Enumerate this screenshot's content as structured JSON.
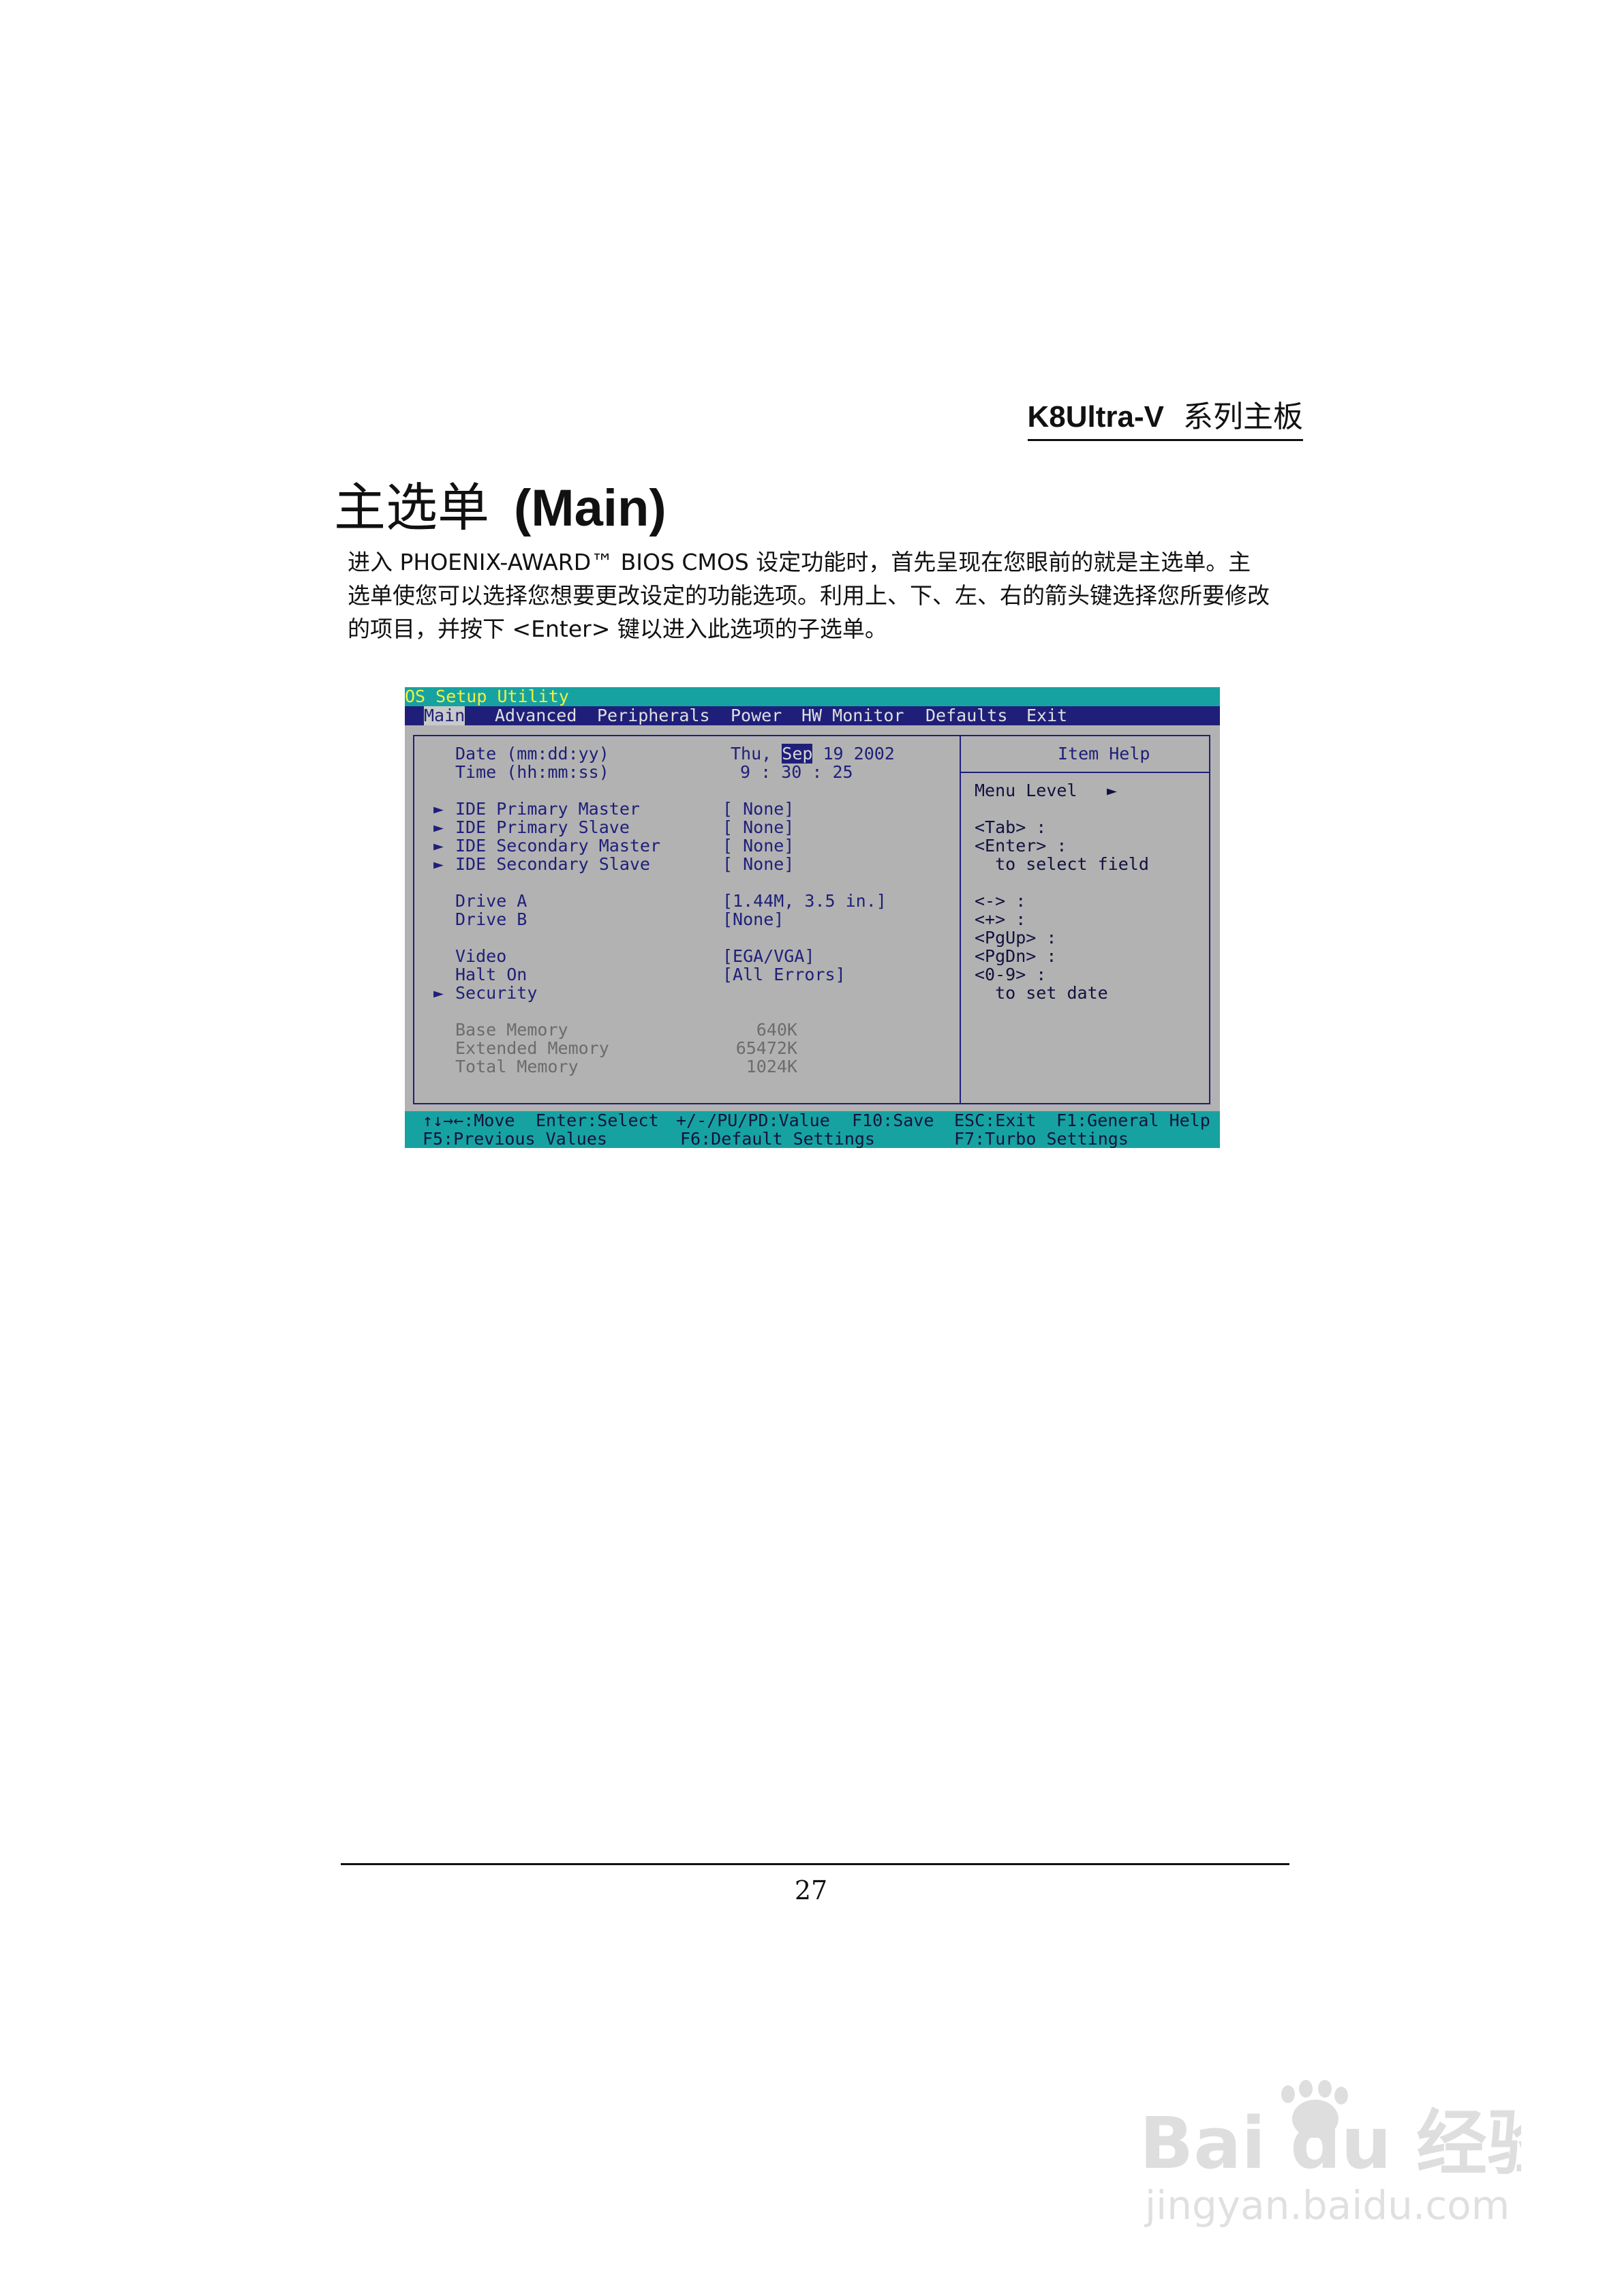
{
  "header": {
    "model": "K8Ultra-V",
    "suffix": "系列主板"
  },
  "section": {
    "title_cn": "主选单",
    "title_en": "(Main)"
  },
  "intro": {
    "lines": [
      "进入 PHOENIX-AWARD™ BIOS CMOS 设定功能时，首先呈现在您眼前的就是主选单。主",
      "选单使您可以选择您想要更改设定的功能选项。利用上、下、左、右的箭头键选择您所要修改",
      "的项目，并按下 <Enter> 键以进入此选项的子选单。"
    ]
  },
  "bios": {
    "title": "OS Setup Utility",
    "menu": [
      "Main",
      "Advanced",
      "Peripherals",
      "Power",
      "HW Monitor",
      "Defaults",
      "Exit"
    ],
    "date": {
      "label": "Date (mm:dd:yy)",
      "day": "Thu,",
      "month": "Sep",
      "rest": "19 2002"
    },
    "time": {
      "label": "Time (hh:mm:ss)",
      "value": "9 : 30 : 25"
    },
    "ide": [
      {
        "arrow": "►",
        "label": "IDE Primary Master",
        "value": "[ None]"
      },
      {
        "arrow": "►",
        "label": "IDE Primary Slave",
        "value": "[ None]"
      },
      {
        "arrow": "►",
        "label": "IDE Secondary Master",
        "value": "[ None]"
      },
      {
        "arrow": "►",
        "label": "IDE Secondary Slave",
        "value": "[ None]"
      }
    ],
    "drives": [
      {
        "label": "Drive A",
        "value": "[1.44M, 3.5 in.]"
      },
      {
        "label": "Drive B",
        "value": "[None]"
      }
    ],
    "video": {
      "label": "Video",
      "value": "[EGA/VGA]"
    },
    "halt": {
      "label": "Halt On",
      "value": "[All Errors]"
    },
    "security": {
      "arrow": "►",
      "label": "Security"
    },
    "memory": [
      {
        "label": "Base Memory",
        "value": "640K"
      },
      {
        "label": "Extended Memory",
        "value": "65472K"
      },
      {
        "label": "Total Memory",
        "value": "1024K"
      }
    ],
    "help": {
      "title": "Item Help",
      "menu_level": "Menu Level",
      "menu_level_arrow": "►",
      "lines": [
        "<Tab> :",
        "<Enter> :",
        "  to select field",
        "<-> :",
        "<+> :",
        "<PgUp> :",
        "<PgDn> :",
        "<0-9> :",
        "  to set date"
      ]
    },
    "footer": {
      "row1": [
        "↑↓→←:Move",
        "Enter:Select",
        "+/-/PU/PD:Value",
        "F10:Save",
        "ESC:Exit",
        "F1:General Help"
      ],
      "row2": [
        "F5:Previous Values",
        "F6:Default Settings",
        "F7:Turbo Settings"
      ]
    }
  },
  "page_number": "27",
  "watermark": {
    "logo_text": "Bai du 经验",
    "url": "jingyan.baidu.com"
  }
}
